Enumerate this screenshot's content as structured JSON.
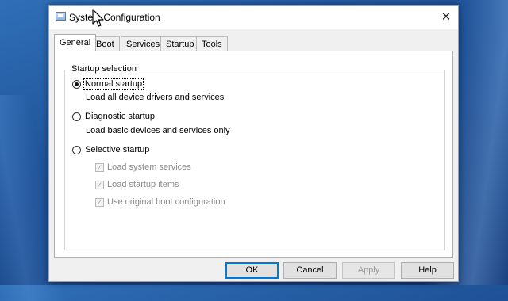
{
  "window": {
    "title": "System Configuration",
    "close_glyph": "✕"
  },
  "tabs": [
    {
      "label": "General",
      "active": true
    },
    {
      "label": "Boot",
      "active": false
    },
    {
      "label": "Services",
      "active": false
    },
    {
      "label": "Startup",
      "active": false
    },
    {
      "label": "Tools",
      "active": false
    }
  ],
  "startup": {
    "group_label": "Startup selection",
    "normal": {
      "label": "Normal startup",
      "desc": "Load all device drivers and services",
      "checked": true
    },
    "diagnostic": {
      "label": "Diagnostic startup",
      "desc": "Load basic devices and services only",
      "checked": false
    },
    "selective": {
      "label": "Selective startup",
      "checked": false
    },
    "options": [
      {
        "label": "Load system services",
        "checked": true,
        "enabled": false
      },
      {
        "label": "Load startup items",
        "checked": true,
        "enabled": false
      },
      {
        "label": "Use original boot configuration",
        "checked": true,
        "enabled": false
      }
    ]
  },
  "buttons": {
    "ok": "OK",
    "cancel": "Cancel",
    "apply": "Apply",
    "help": "Help"
  },
  "colors": {
    "accent": "#0078d7",
    "desktop": "#1d4f94"
  },
  "icons": {
    "app": "system-configuration-icon",
    "close": "close-icon",
    "check": "checkmark-icon",
    "cursor": "mouse-pointer-icon"
  }
}
